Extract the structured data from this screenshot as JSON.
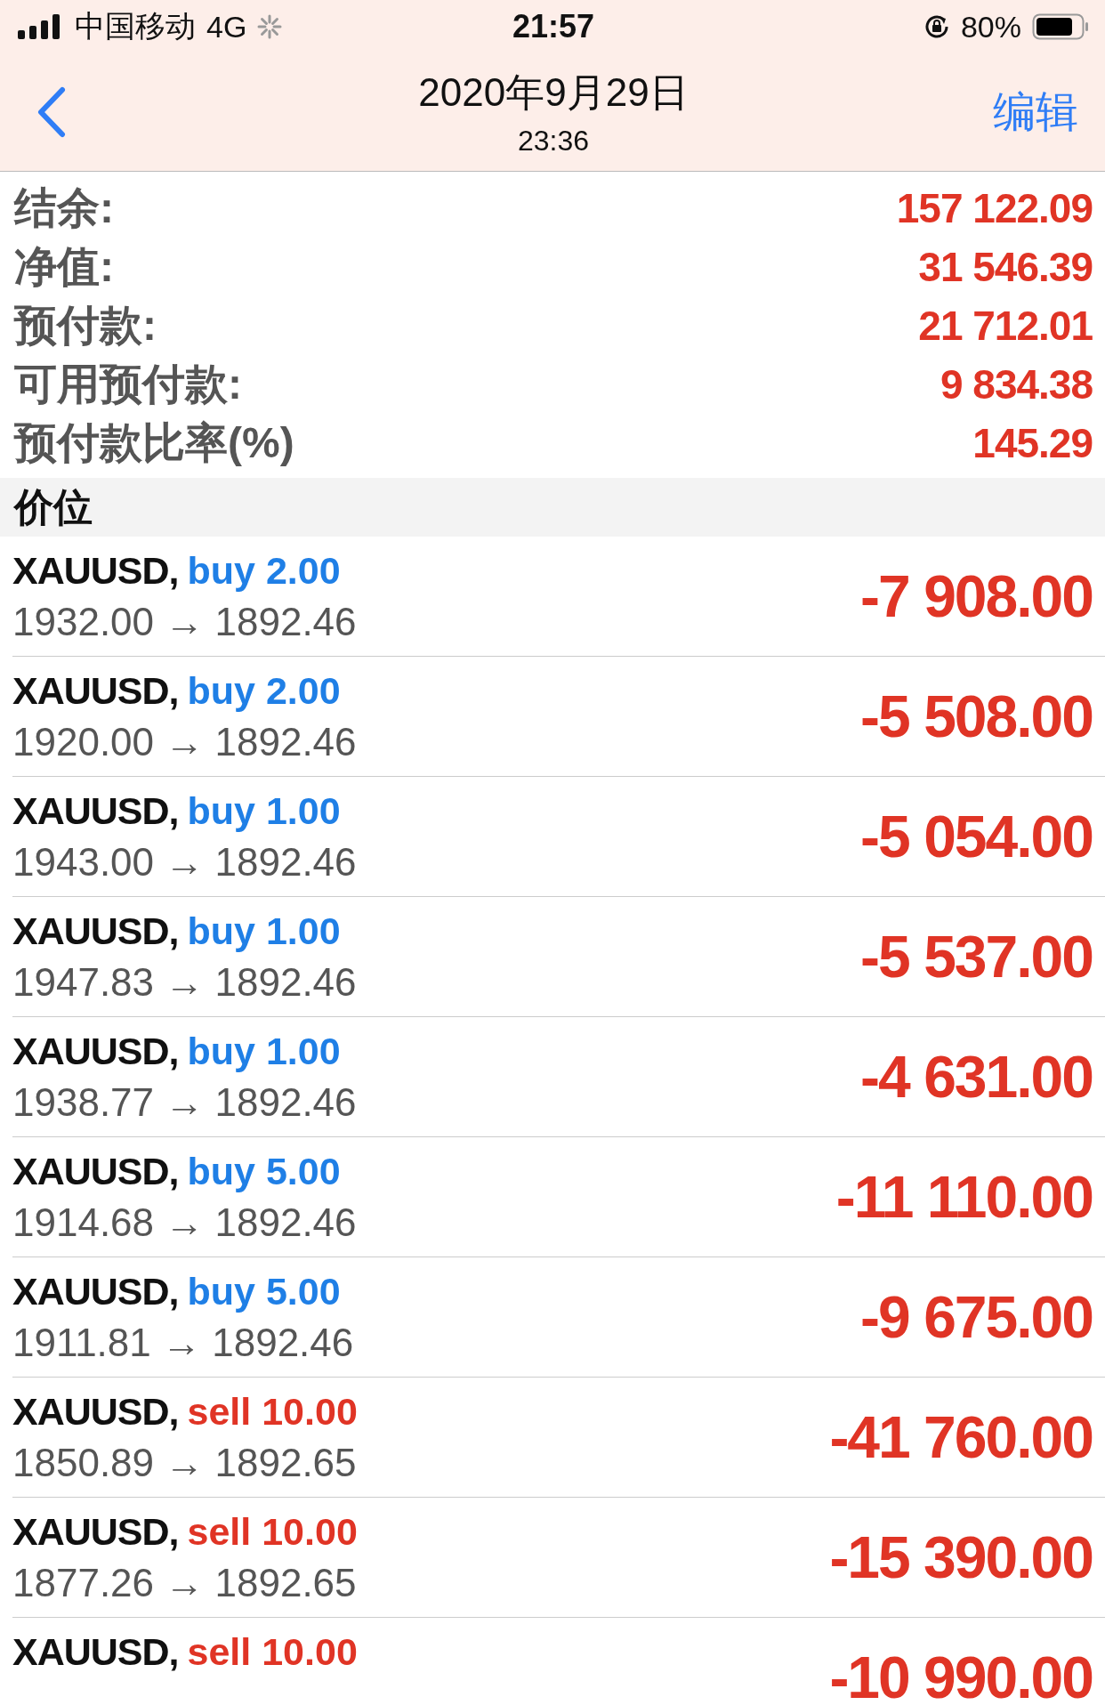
{
  "status_bar": {
    "carrier": "中国移动",
    "network": "4G",
    "time": "21:57",
    "battery": "80%"
  },
  "nav": {
    "title": "2020年9月29日",
    "subtitle": "23:36",
    "action": "编辑"
  },
  "summary": [
    {
      "label": "结余:",
      "value": "157 122.09"
    },
    {
      "label": "净值:",
      "value": "31 546.39"
    },
    {
      "label": "预付款:",
      "value": "21 712.01"
    },
    {
      "label": "可用预付款:",
      "value": "9 834.38"
    },
    {
      "label": "预付款比率(%)",
      "value": "145.29"
    }
  ],
  "section": "价位",
  "positions": [
    {
      "symbol": "XAUUSD,",
      "kind": "buy",
      "order": "buy 2.00",
      "prices": "1932.00 → 1892.46",
      "profit": "-7 908.00"
    },
    {
      "symbol": "XAUUSD,",
      "kind": "buy",
      "order": "buy 2.00",
      "prices": "1920.00 → 1892.46",
      "profit": "-5 508.00"
    },
    {
      "symbol": "XAUUSD,",
      "kind": "buy",
      "order": "buy 1.00",
      "prices": "1943.00 → 1892.46",
      "profit": "-5 054.00"
    },
    {
      "symbol": "XAUUSD,",
      "kind": "buy",
      "order": "buy 1.00",
      "prices": "1947.83 → 1892.46",
      "profit": "-5 537.00"
    },
    {
      "symbol": "XAUUSD,",
      "kind": "buy",
      "order": "buy 1.00",
      "prices": "1938.77 → 1892.46",
      "profit": "-4 631.00"
    },
    {
      "symbol": "XAUUSD,",
      "kind": "buy",
      "order": "buy 5.00",
      "prices": "1914.68 → 1892.46",
      "profit": "-11 110.00"
    },
    {
      "symbol": "XAUUSD,",
      "kind": "buy",
      "order": "buy 5.00",
      "prices": "1911.81 → 1892.46",
      "profit": "-9 675.00"
    },
    {
      "symbol": "XAUUSD,",
      "kind": "sell",
      "order": "sell 10.00",
      "prices": "1850.89 → 1892.65",
      "profit": "-41 760.00"
    },
    {
      "symbol": "XAUUSD,",
      "kind": "sell",
      "order": "sell 10.00",
      "prices": "1877.26 → 1892.65",
      "profit": "-15 390.00"
    },
    {
      "symbol": "XAUUSD,",
      "kind": "sell",
      "order": "sell 10.00",
      "profit": "-10 990.00"
    }
  ]
}
